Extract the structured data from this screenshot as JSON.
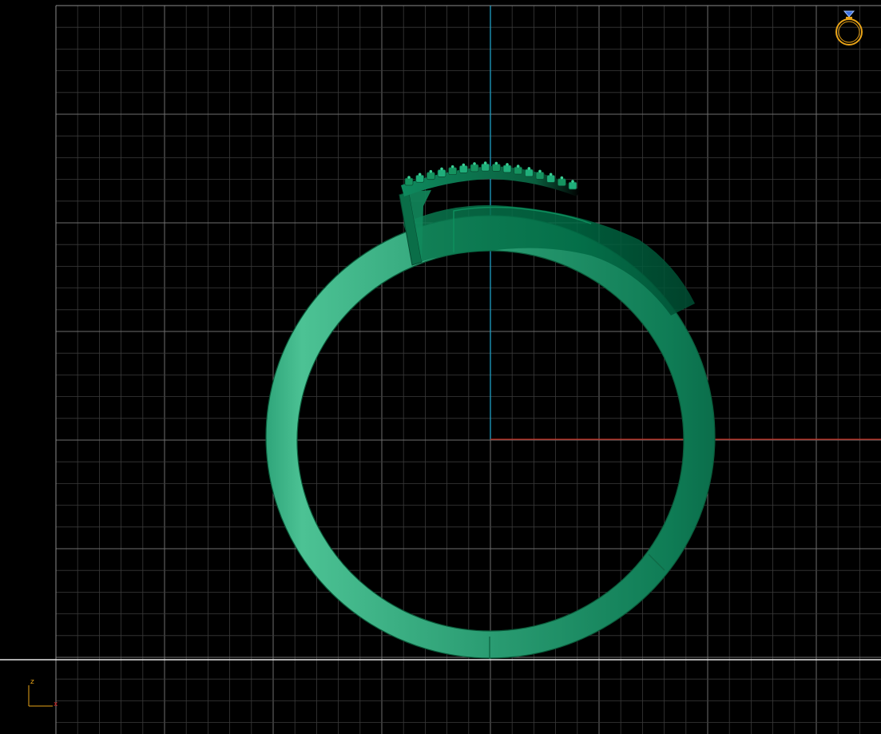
{
  "viewport": {
    "background": "#000000",
    "grid_minor_color": "#3a3a3a",
    "grid_major_color": "#6e6e6e"
  },
  "axes": {
    "vertical_axis_color": "#1e9fc4",
    "horizontal_axis_color": "#c42a1e",
    "ground_line_color": "#e6e6e6"
  },
  "model": {
    "name": "ring",
    "shank_color_light": "#3fb98a",
    "shank_color_dark": "#006b45",
    "outline_color": "#0b5a3a"
  },
  "view_cube": {
    "icon": "ring-with-gem-icon",
    "ring_color": "#e8a317",
    "gem_color": "#3a6fe0"
  },
  "axis_indicator": {
    "z_label": "z",
    "x_label": "x",
    "color": "#e8a317",
    "x_color": "#d02020"
  }
}
